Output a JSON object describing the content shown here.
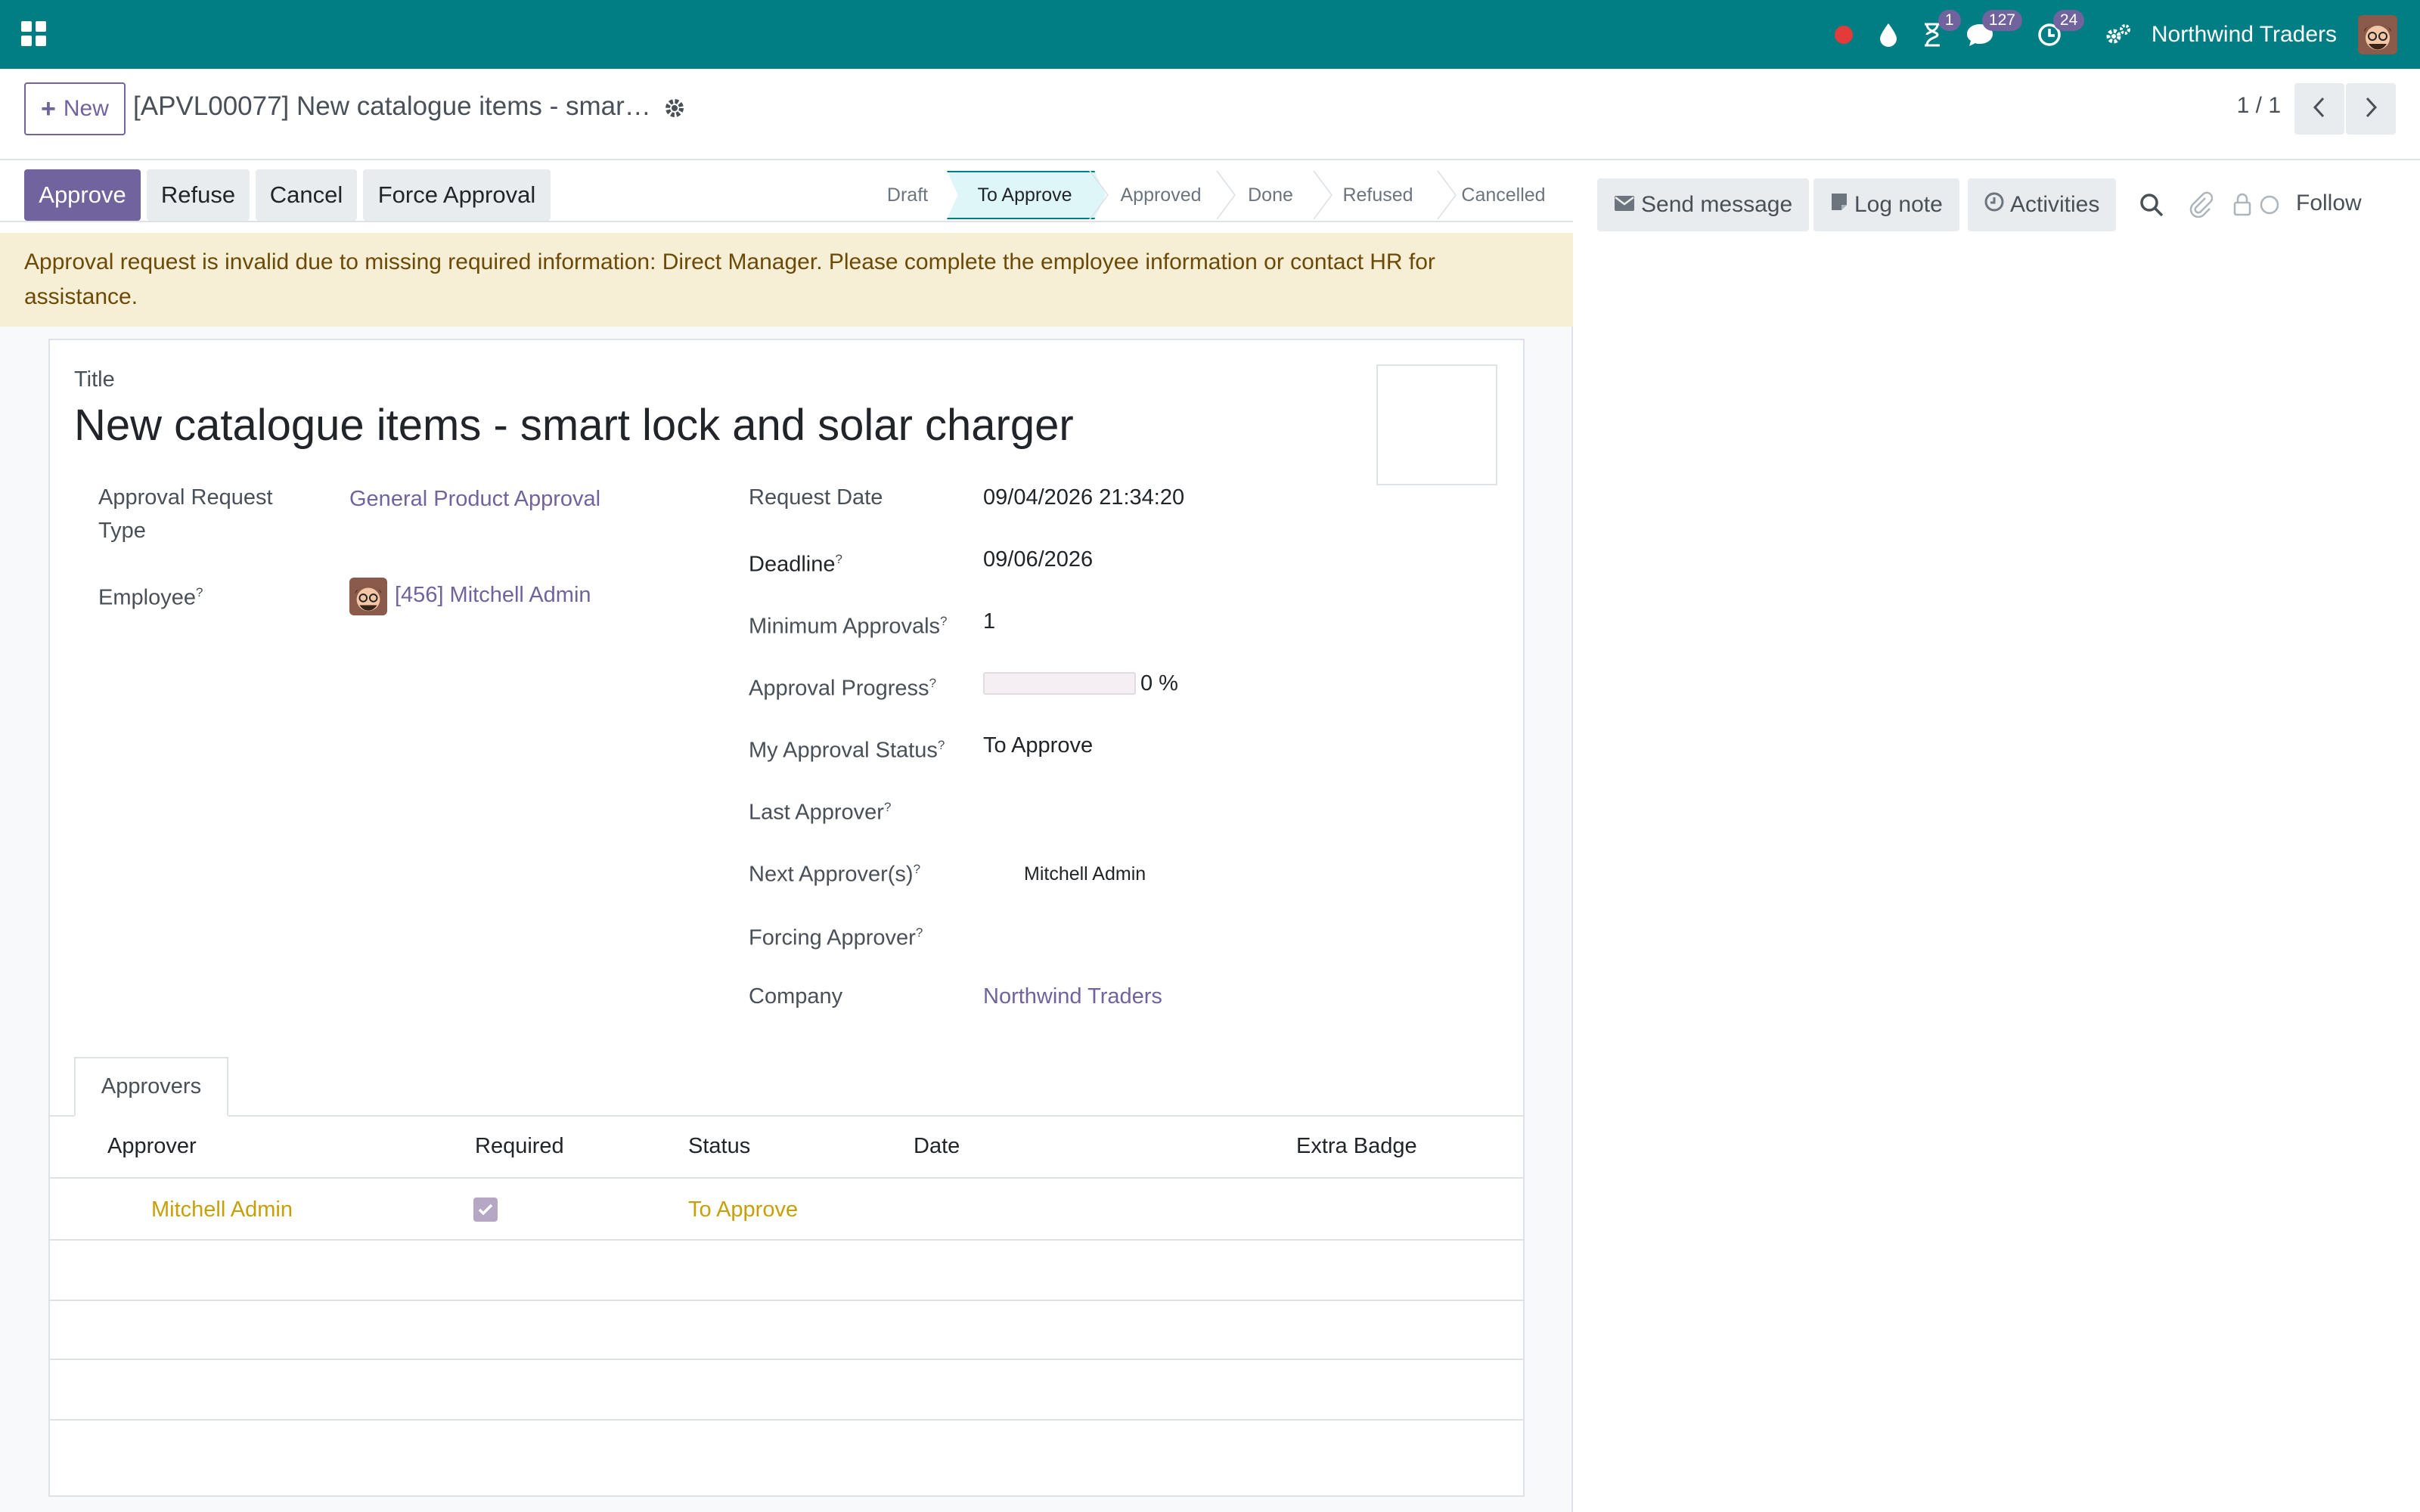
{
  "navbar": {
    "badges": {
      "activities": "1",
      "messages": "127",
      "timer": "24"
    },
    "company": "Northwind Traders"
  },
  "control_panel": {
    "new_label": "New",
    "breadcrumb": "[APVL00077] New catalogue items - smar…",
    "pager": "1 / 1"
  },
  "actions": {
    "approve": "Approve",
    "refuse": "Refuse",
    "cancel": "Cancel",
    "force": "Force Approval"
  },
  "stages": [
    {
      "label": "Draft",
      "active": false
    },
    {
      "label": "To Approve",
      "active": true
    },
    {
      "label": "Approved",
      "active": false
    },
    {
      "label": "Done",
      "active": false
    },
    {
      "label": "Refused",
      "active": false
    },
    {
      "label": "Cancelled",
      "active": false
    }
  ],
  "alert": "Approval request is invalid due to missing required information: Direct Manager. Please complete the employee information or contact HR for assistance.",
  "form": {
    "title_label": "Title",
    "title": "New catalogue items - smart lock and solar charger",
    "request_type_label": "Approval Request Type",
    "request_type": "General Product Approval",
    "employee_label": "Employee",
    "employee": "[456] Mitchell Admin",
    "request_date_label": "Request Date",
    "request_date": "09/04/2026 21:34:20",
    "deadline_label": "Deadline",
    "deadline": "09/06/2026",
    "min_approvals_label": "Minimum Approvals",
    "min_approvals": "1",
    "progress_label": "Approval Progress",
    "progress": "0 %",
    "progress_value": 0,
    "my_status_label": "My Approval Status",
    "my_status": "To Approve",
    "last_approver_label": "Last Approver",
    "next_approvers_label": "Next Approver(s)",
    "next_approvers": "Mitchell Admin",
    "forcing_approver_label": "Forcing Approver",
    "company_label": "Company",
    "company": "Northwind Traders",
    "help_mark": "?"
  },
  "approvers_tab": {
    "tab_label": "Approvers",
    "columns": {
      "approver": "Approver",
      "required": "Required",
      "status": "Status",
      "date": "Date",
      "extra_badge": "Extra Badge"
    },
    "rows": [
      {
        "approver": "Mitchell Admin",
        "required": true,
        "status": "To Approve",
        "date": "",
        "extra_badge": ""
      }
    ]
  },
  "chatter": {
    "send_message": "Send message",
    "log_note": "Log note",
    "activities": "Activities",
    "follow": "Follow"
  },
  "colors": {
    "navbar": "#017e84",
    "primary": "#71639e",
    "status_warning": "#c7a008",
    "alert_bg": "#f6efd5"
  }
}
